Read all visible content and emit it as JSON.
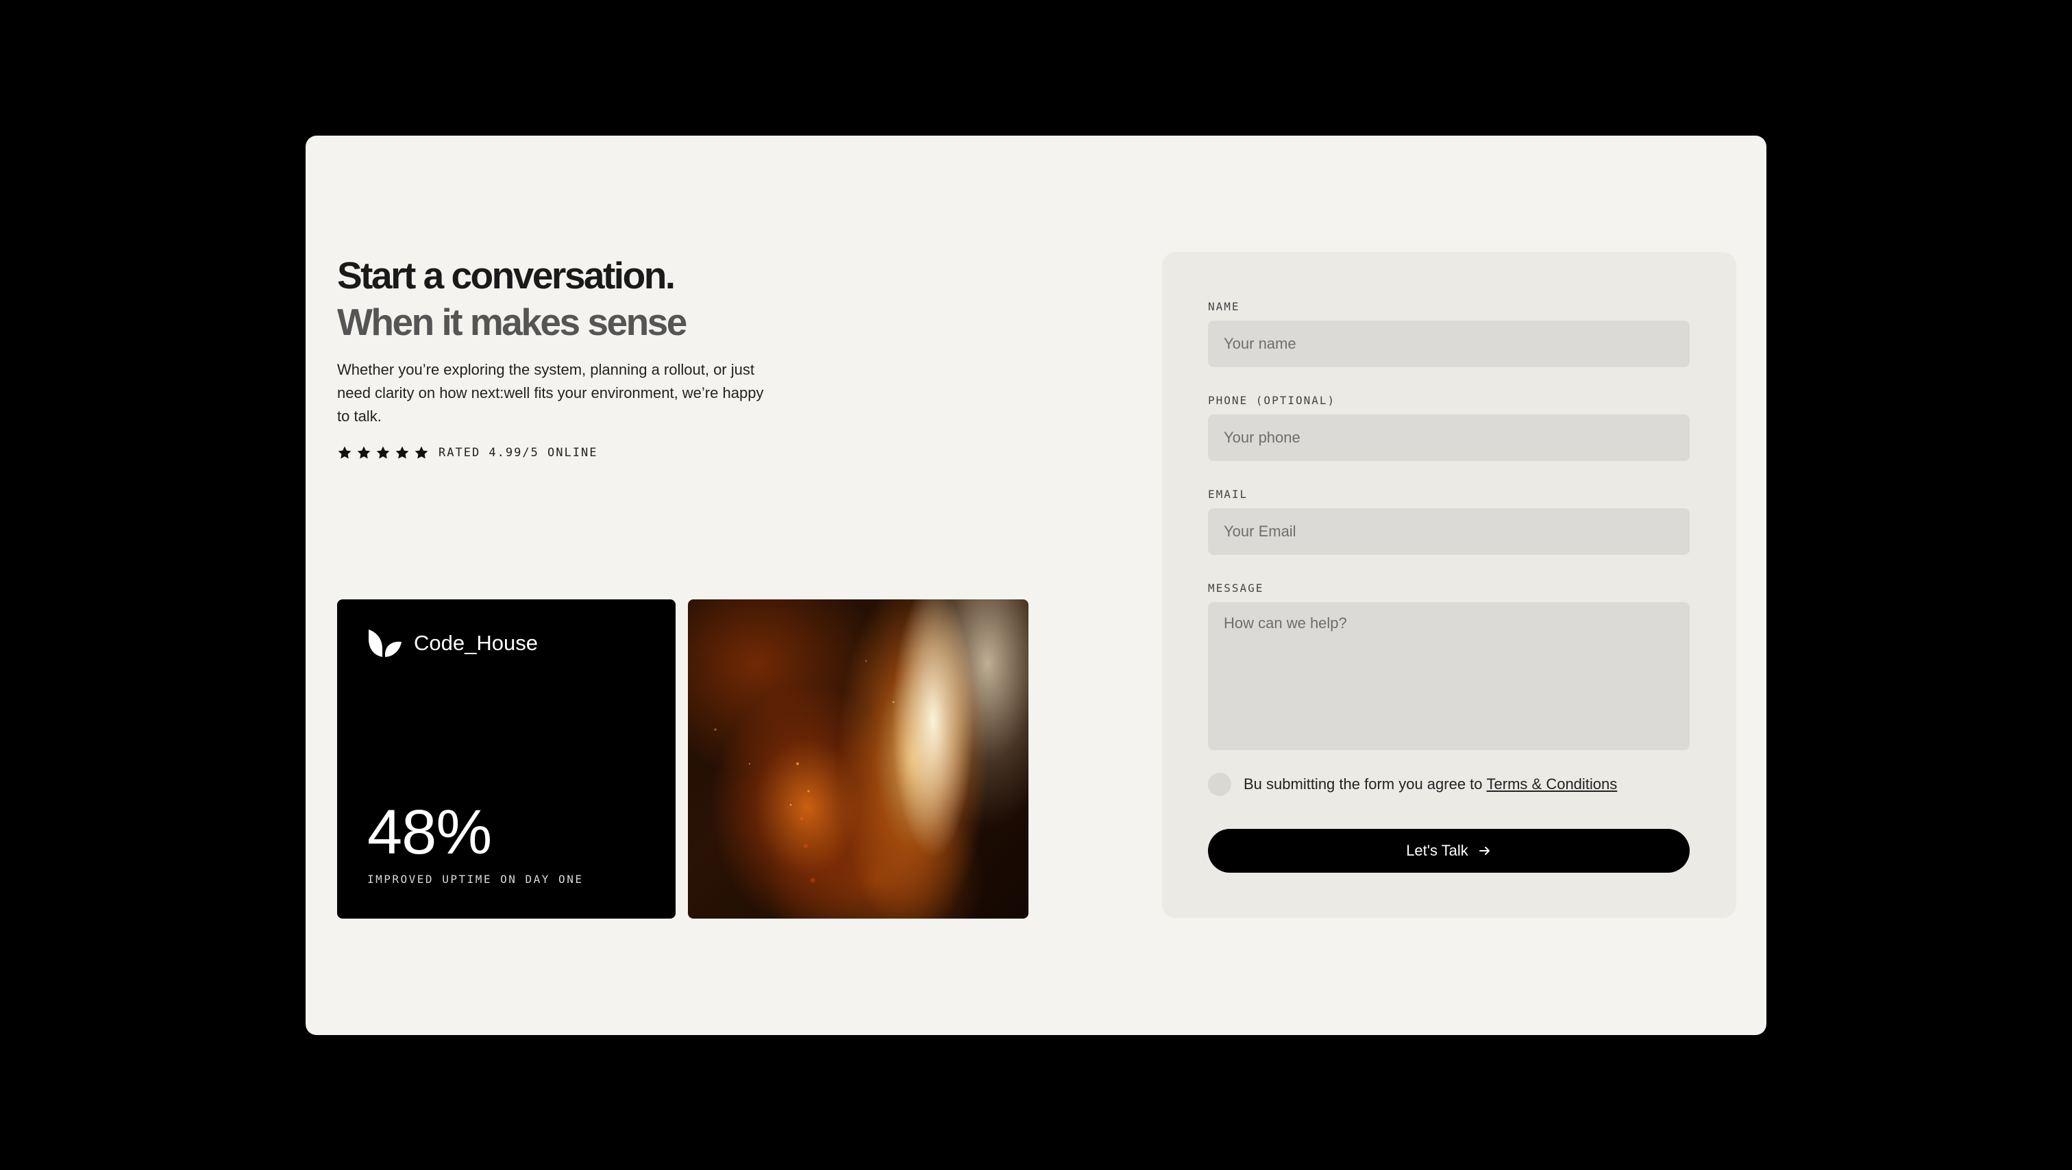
{
  "hero": {
    "title_line1": "Start a conversation.",
    "title_line2": "When it makes sense",
    "intro": "Whether you’re exploring the system, planning a rollout, or just need clarity on how next:well fits your environment, we’re happy to talk.",
    "rating": {
      "stars": 5,
      "text": "RATED 4.99/5 ONLINE"
    }
  },
  "stat_card": {
    "brand": "Code_House",
    "value": "48%",
    "caption": "IMPROVED UPTIME ON DAY ONE"
  },
  "form": {
    "name": {
      "label": "NAME",
      "placeholder": "Your name",
      "value": ""
    },
    "phone": {
      "label": "PHONE (OPTIONAL)",
      "placeholder": "Your phone",
      "value": ""
    },
    "email": {
      "label": "EMAIL",
      "placeholder": "Your Email",
      "value": ""
    },
    "message": {
      "label": "MESSAGE",
      "placeholder": "How can we help?",
      "value": ""
    },
    "agree_text": "Bu submitting the form you agree to",
    "terms_link": "Terms & Conditions",
    "agree_checked": false,
    "submit_label": "Let's Talk"
  },
  "colors": {
    "page_bg": "#000000",
    "card_bg": "#f4f3ef",
    "form_bg": "#ebeae5",
    "input_bg": "#dbdad6",
    "button_bg": "#000000"
  }
}
